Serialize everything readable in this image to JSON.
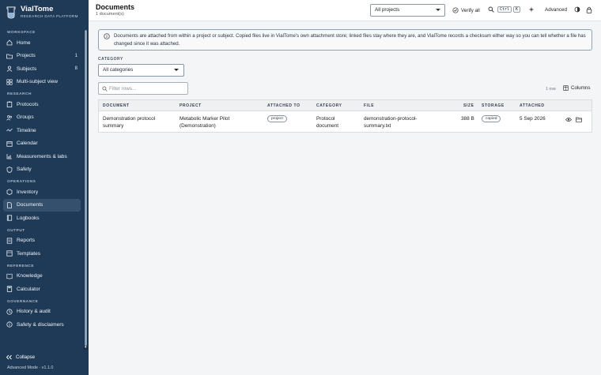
{
  "app": {
    "name": "VialTome",
    "tagline": "RESEARCH DATA PLATFORM"
  },
  "sidebar": {
    "sections": {
      "workspace": "WORKSPACE",
      "research": "RESEARCH",
      "operations": "OPERATIONS",
      "output": "OUTPUT",
      "reference": "REFERENCE",
      "governance": "GOVERNANCE"
    },
    "items": {
      "home": "Home",
      "projects": "Projects",
      "projects_count": "1",
      "subjects": "Subjects",
      "subjects_count": "8",
      "multi_subject": "Multi-subject view",
      "protocols": "Protocols",
      "groups": "Groups",
      "timeline": "Timeline",
      "calendar": "Calendar",
      "measurements": "Measurements & labs",
      "safety": "Safety",
      "inventory": "Inventory",
      "documents": "Documents",
      "logbooks": "Logbooks",
      "reports": "Reports",
      "templates": "Templates",
      "knowledge": "Knowledge",
      "calculator": "Calculator",
      "history": "History & audit",
      "safety_disclaimers": "Safety & disclaimers"
    },
    "collapse_label": "Collapse",
    "mode_label": "Advanced Mode · v1.1.0"
  },
  "topbar": {
    "title": "Documents",
    "subtitle": "1 document(s)",
    "project_select": "All projects",
    "verify_label": "Verify all",
    "kbd_ctrl": "Ctrl",
    "kbd_k": "K",
    "advanced_label": "Advanced"
  },
  "info_banner": "Documents are attached from within a project or subject. Copied files live in VialTome's own attachment store; linked files stay where they are, and VialTome records a checksum either way so you can tell whether a file has changed since it was attached.",
  "filters": {
    "category_label": "CATEGORY",
    "category_value": "All categories",
    "filter_placeholder": "Filter rows...",
    "row_count": "1 row",
    "columns_label": "Columns"
  },
  "table": {
    "headers": {
      "document": "DOCUMENT",
      "project": "PROJECT",
      "attached_to": "ATTACHED TO",
      "category": "CATEGORY",
      "file": "FILE",
      "size": "SIZE",
      "storage": "STORAGE",
      "attached": "ATTACHED"
    },
    "rows": [
      {
        "document_l1": "Demonstration protocol",
        "document_l2": "summary",
        "project_l1": "Metabolic Marker Pilot",
        "project_l2": "(Demonstration)",
        "attached_to": "project",
        "category_l1": "Protocol",
        "category_l2": "document",
        "file_l1": "demonstration-protocol-",
        "file_l2": "summary.txt",
        "size": "388 B",
        "storage": "copied",
        "attached": "5 Sep 2026"
      }
    ]
  },
  "colors": {
    "sidebar_bg": "#1f3a57",
    "sidebar_active": "#34506c",
    "page_bg": "#f4f5f7"
  }
}
